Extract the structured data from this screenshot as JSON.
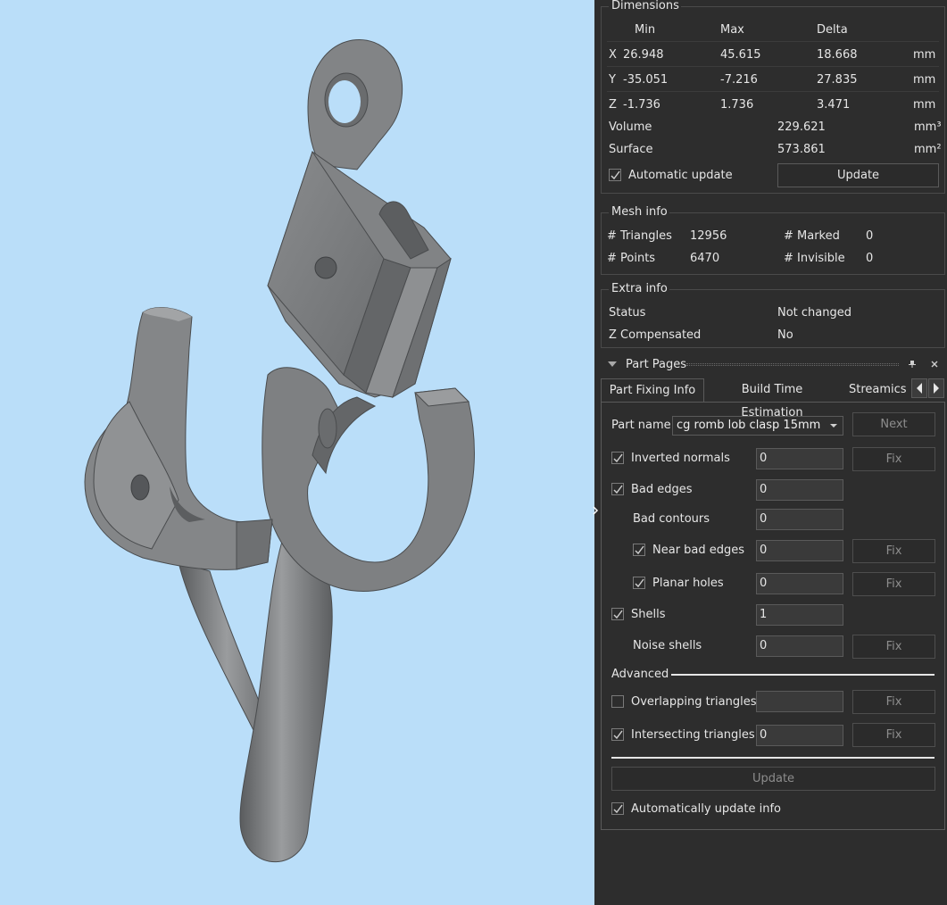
{
  "dimensions": {
    "title": "Dimensions",
    "headers": [
      "Min",
      "Max",
      "Delta"
    ],
    "rows": [
      {
        "axis": "X",
        "min": "26.948",
        "max": "45.615",
        "delta": "18.668",
        "unit": "mm"
      },
      {
        "axis": "Y",
        "min": "-35.051",
        "max": "-7.216",
        "delta": "27.835",
        "unit": "mm"
      },
      {
        "axis": "Z",
        "min": "-1.736",
        "max": "1.736",
        "delta": "3.471",
        "unit": "mm"
      }
    ],
    "volume_label": "Volume",
    "volume_value": "229.621",
    "volume_unit": "mm³",
    "surface_label": "Surface",
    "surface_value": "573.861",
    "surface_unit": "mm²",
    "auto_update_label": "Automatic update",
    "auto_update_checked": true,
    "update_button": "Update"
  },
  "mesh_info": {
    "title": "Mesh info",
    "triangles_label": "# Triangles",
    "triangles_value": "12956",
    "points_label": "# Points",
    "points_value": "6470",
    "marked_label": "# Marked",
    "marked_value": "0",
    "invisible_label": "# Invisible",
    "invisible_value": "0"
  },
  "extra_info": {
    "title": "Extra info",
    "status_label": "Status",
    "status_value": "Not changed",
    "zcomp_label": "Z Compensated",
    "zcomp_value": "No"
  },
  "part_pages": {
    "title": "Part Pages",
    "tabs": [
      "Part Fixing Info",
      "Build Time Estimation",
      "Streamics P"
    ],
    "active_tab": 0,
    "part_name_label": "Part name",
    "part_name_value": "cg romb lob clasp 15mm",
    "next_button": "Next",
    "fix_label": "Fix",
    "rows": {
      "inverted_normals": {
        "label": "Inverted normals",
        "value": "0",
        "checked": true
      },
      "bad_edges": {
        "label": "Bad edges",
        "value": "0",
        "checked": true
      },
      "bad_contours": {
        "label": "Bad contours",
        "value": "0"
      },
      "near_bad_edges": {
        "label": "Near bad edges",
        "value": "0",
        "checked": true
      },
      "planar_holes": {
        "label": "Planar holes",
        "value": "0",
        "checked": true
      },
      "shells": {
        "label": "Shells",
        "value": "1",
        "checked": true
      },
      "noise_shells": {
        "label": "Noise shells",
        "value": "0"
      },
      "overlapping_triangles": {
        "label": "Overlapping triangles",
        "value": "",
        "checked": false
      },
      "intersecting_triangles": {
        "label": "Intersecting triangles",
        "value": "0",
        "checked": true
      }
    },
    "advanced_label": "Advanced",
    "update_button": "Update",
    "auto_update_info_label": "Automatically update info",
    "auto_update_info_checked": true
  },
  "colors": {
    "viewport_bg": "#badef9",
    "panel_bg": "#2d2d2d",
    "model": "#7a7c7e"
  }
}
